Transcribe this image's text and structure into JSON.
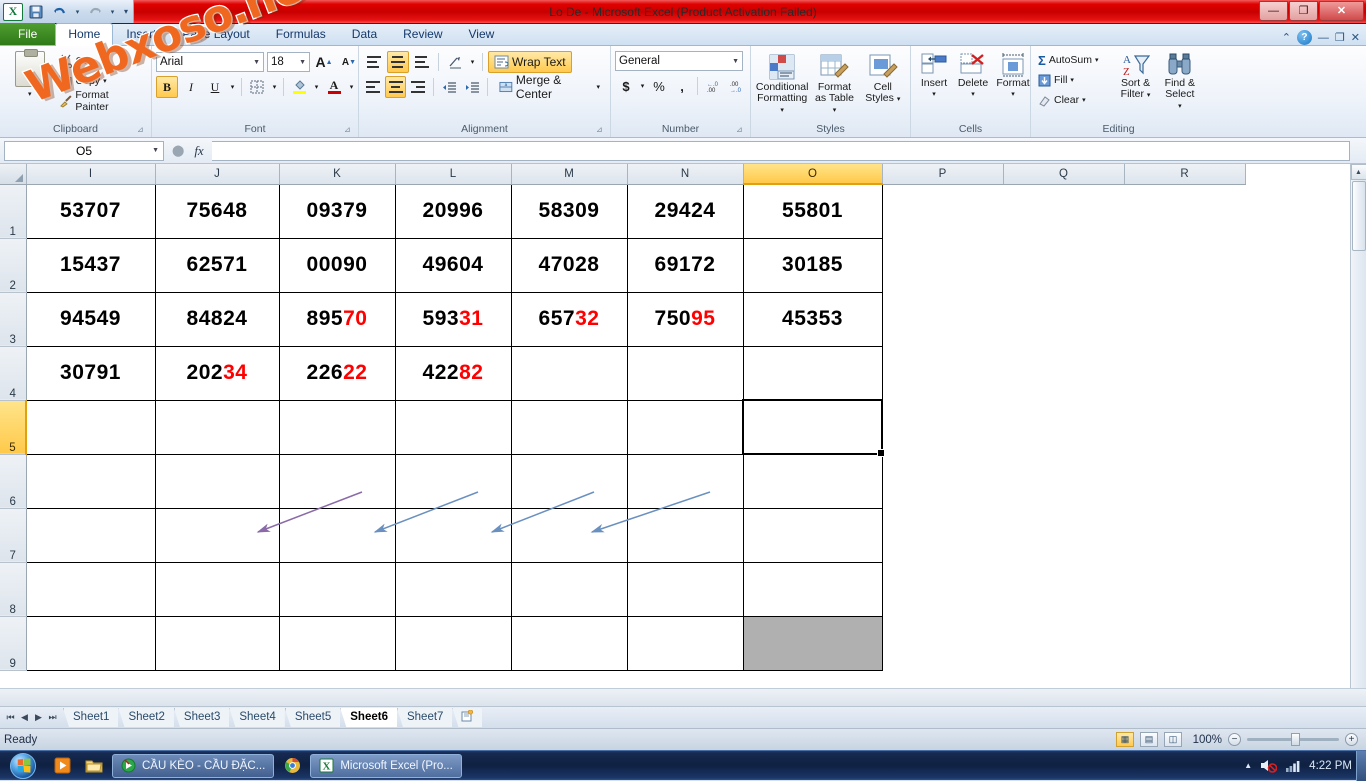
{
  "window": {
    "title": "Lo De  -  Microsoft Excel (Product Activation Failed)",
    "minimize": "—",
    "restore": "❐",
    "close": "✕"
  },
  "quick_access": {
    "save": "💾",
    "undo": "↰",
    "redo": "↱",
    "customize": "▾"
  },
  "watermark": "Webxoso.net",
  "tabs": [
    {
      "label": "File",
      "active": false,
      "file": true
    },
    {
      "label": "Home",
      "active": true,
      "file": false
    },
    {
      "label": "Insert",
      "active": false,
      "file": false
    },
    {
      "label": "Page Layout",
      "active": false,
      "file": false
    },
    {
      "label": "Formulas",
      "active": false,
      "file": false
    },
    {
      "label": "Data",
      "active": false,
      "file": false
    },
    {
      "label": "Review",
      "active": false,
      "file": false
    },
    {
      "label": "View",
      "active": false,
      "file": false
    }
  ],
  "tab_right": {
    "collapse": "⌃",
    "help": "?",
    "doc_minimize": "—",
    "doc_restore": "❐",
    "doc_close": "✕"
  },
  "ribbon": {
    "clipboard": {
      "label": "Clipboard",
      "paste": "Paste",
      "cut": "Cut",
      "copy": "Copy",
      "format_painter": "Format Painter"
    },
    "font": {
      "label": "Font",
      "family": "Arial",
      "size": "18",
      "grow": "A",
      "shrink": "A",
      "bold": "B",
      "italic": "I",
      "underline": "U",
      "border": "▦",
      "fill": "▼",
      "color": "A"
    },
    "alignment": {
      "label": "Alignment",
      "wrap_text": "Wrap Text",
      "merge_center": "Merge & Center",
      "orientation": "↗"
    },
    "number": {
      "label": "Number",
      "format": "General",
      "currency": "$",
      "percent": "%",
      "comma": ",",
      "inc_dec": "＋.0",
      "dec_dec": "−.00"
    },
    "styles": {
      "label": "Styles",
      "conditional": "Conditional\nFormatting",
      "conditional_l1": "Conditional",
      "conditional_l2": "Formatting",
      "table_l1": "Format",
      "table_l2": "as Table",
      "cellstyles_l1": "Cell",
      "cellstyles_l2": "Styles"
    },
    "cells": {
      "label": "Cells",
      "insert": "Insert",
      "delete": "Delete",
      "format": "Format"
    },
    "editing": {
      "label": "Editing",
      "autosum": "AutoSum",
      "fill": "Fill",
      "clear": "Clear",
      "sort_l1": "Sort &",
      "sort_l2": "Filter",
      "find_l1": "Find &",
      "find_l2": "Select"
    }
  },
  "formula_bar": {
    "name_box": "O5",
    "formula": "",
    "fx": "fx",
    "cancel": "✕",
    "enter": "✓"
  },
  "grid": {
    "columns": [
      "I",
      "J",
      "K",
      "L",
      "M",
      "N",
      "O",
      "P",
      "Q",
      "R"
    ],
    "selected_column": "O",
    "rows": [
      "1",
      "2",
      "3",
      "4",
      "5",
      "6",
      "7",
      "8",
      "9"
    ],
    "selected_row": "5",
    "selected_cell": "O5",
    "data": [
      {
        "row": "1",
        "cells": [
          {
            "col": "I",
            "black": "53707",
            "red": ""
          },
          {
            "col": "J",
            "black": "75648",
            "red": ""
          },
          {
            "col": "K",
            "black": "09379",
            "red": ""
          },
          {
            "col": "L",
            "black": "20996",
            "red": ""
          },
          {
            "col": "M",
            "black": "58309",
            "red": ""
          },
          {
            "col": "N",
            "black": "29424",
            "red": ""
          },
          {
            "col": "O",
            "black": "55801",
            "red": ""
          }
        ]
      },
      {
        "row": "2",
        "cells": [
          {
            "col": "I",
            "black": "15437",
            "red": ""
          },
          {
            "col": "J",
            "black": "62571",
            "red": ""
          },
          {
            "col": "K",
            "black": "00090",
            "red": ""
          },
          {
            "col": "L",
            "black": "49604",
            "red": ""
          },
          {
            "col": "M",
            "black": "47028",
            "red": ""
          },
          {
            "col": "N",
            "black": "69172",
            "red": ""
          },
          {
            "col": "O",
            "black": "30185",
            "red": ""
          }
        ]
      },
      {
        "row": "3",
        "cells": [
          {
            "col": "I",
            "black": "94549",
            "red": ""
          },
          {
            "col": "J",
            "black": "84824",
            "red": ""
          },
          {
            "col": "K",
            "black": "895",
            "red": "70"
          },
          {
            "col": "L",
            "black": "593",
            "red": "31"
          },
          {
            "col": "M",
            "black": "657",
            "red": "32"
          },
          {
            "col": "N",
            "black": "750",
            "red": "95"
          },
          {
            "col": "O",
            "black": "45353",
            "red": ""
          }
        ]
      },
      {
        "row": "4",
        "cells": [
          {
            "col": "I",
            "black": "30791",
            "red": ""
          },
          {
            "col": "J",
            "black": "202",
            "red": "34"
          },
          {
            "col": "K",
            "black": "226",
            "red": "22"
          },
          {
            "col": "L",
            "black": "422",
            "red": "82"
          },
          {
            "col": "M",
            "black": "",
            "red": ""
          },
          {
            "col": "N",
            "black": "",
            "red": ""
          },
          {
            "col": "O",
            "black": "",
            "red": ""
          }
        ]
      },
      {
        "row": "5",
        "cells": [
          {
            "col": "I",
            "black": "",
            "red": ""
          },
          {
            "col": "J",
            "black": "",
            "red": ""
          },
          {
            "col": "K",
            "black": "",
            "red": ""
          },
          {
            "col": "L",
            "black": "",
            "red": ""
          },
          {
            "col": "M",
            "black": "",
            "red": ""
          },
          {
            "col": "N",
            "black": "",
            "red": ""
          },
          {
            "col": "O",
            "black": "",
            "red": ""
          }
        ]
      },
      {
        "row": "6",
        "cells": [
          {
            "col": "I",
            "black": "",
            "red": ""
          },
          {
            "col": "J",
            "black": "",
            "red": ""
          },
          {
            "col": "K",
            "black": "",
            "red": ""
          },
          {
            "col": "L",
            "black": "",
            "red": ""
          },
          {
            "col": "M",
            "black": "",
            "red": ""
          },
          {
            "col": "N",
            "black": "",
            "red": ""
          },
          {
            "col": "O",
            "black": "",
            "red": ""
          }
        ]
      },
      {
        "row": "7",
        "cells": [
          {
            "col": "I",
            "black": "",
            "red": ""
          },
          {
            "col": "J",
            "black": "",
            "red": ""
          },
          {
            "col": "K",
            "black": "",
            "red": ""
          },
          {
            "col": "L",
            "black": "",
            "red": ""
          },
          {
            "col": "M",
            "black": "",
            "red": ""
          },
          {
            "col": "N",
            "black": "",
            "red": ""
          },
          {
            "col": "O",
            "black": "",
            "red": ""
          }
        ]
      },
      {
        "row": "8",
        "cells": [
          {
            "col": "I",
            "black": "",
            "red": ""
          },
          {
            "col": "J",
            "black": "",
            "red": ""
          },
          {
            "col": "K",
            "black": "",
            "red": ""
          },
          {
            "col": "L",
            "black": "",
            "red": ""
          },
          {
            "col": "M",
            "black": "",
            "red": ""
          },
          {
            "col": "N",
            "black": "",
            "red": ""
          },
          {
            "col": "O",
            "black": "",
            "red": ""
          }
        ]
      },
      {
        "row": "9",
        "cells": [
          {
            "col": "I",
            "black": "",
            "red": ""
          },
          {
            "col": "J",
            "black": "",
            "red": ""
          },
          {
            "col": "K",
            "black": "",
            "red": ""
          },
          {
            "col": "L",
            "black": "",
            "red": ""
          },
          {
            "col": "M",
            "black": "",
            "red": ""
          },
          {
            "col": "N",
            "black": "",
            "red": ""
          },
          {
            "col": "O",
            "black": "",
            "red": "",
            "gray": true
          }
        ]
      }
    ],
    "annotation_arrows": [
      {
        "from": "K3",
        "to": "J4",
        "color": "#8a6aa8"
      },
      {
        "from": "L3",
        "to": "K4",
        "color": "#6a90c0"
      },
      {
        "from": "M3",
        "to": "L4",
        "color": "#6a90c0"
      },
      {
        "from": "N3",
        "to": "M4",
        "color": "#6a90c0"
      }
    ],
    "gray_cell": "O9"
  },
  "sheet_tabs": {
    "nav": [
      "⏮",
      "◀",
      "▶",
      "⏭"
    ],
    "sheets": [
      {
        "label": "Sheet1",
        "active": false
      },
      {
        "label": "Sheet2",
        "active": false
      },
      {
        "label": "Sheet3",
        "active": false
      },
      {
        "label": "Sheet4",
        "active": false
      },
      {
        "label": "Sheet5",
        "active": false
      },
      {
        "label": "Sheet6",
        "active": true
      },
      {
        "label": "Sheet7",
        "active": false
      }
    ],
    "new_sheet": "✳"
  },
  "status_bar": {
    "state": "Ready",
    "view_normal": "▦",
    "view_layout": "▤",
    "view_break": "◫",
    "zoom": "100%",
    "zoom_out": "−",
    "zoom_in": "+"
  },
  "taskbar": {
    "start": "start",
    "quicklaunch": [
      "media-player",
      "explorer"
    ],
    "items": [
      {
        "label": "CẦU KÈO - CẦU ĐẶC...",
        "icon": "browser"
      },
      {
        "label": "Microsoft Excel (Pro...",
        "icon": "excel"
      }
    ],
    "chrome": "chrome",
    "tray": {
      "show_hidden": "▲",
      "volume": "mute",
      "network": "signal",
      "clock": "4:22 PM"
    }
  }
}
